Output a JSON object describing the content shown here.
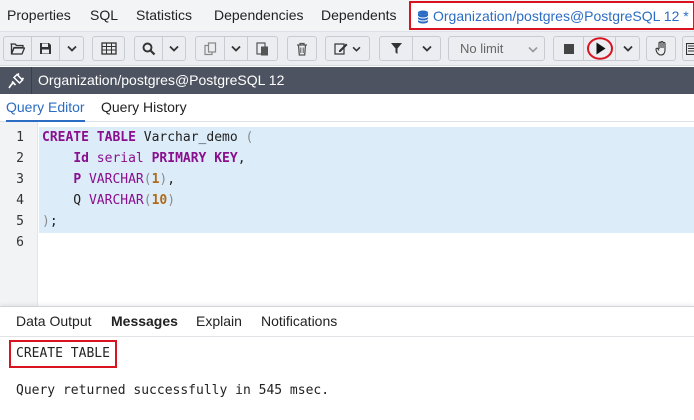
{
  "tabs": [
    {
      "label": "Properties"
    },
    {
      "label": "SQL"
    },
    {
      "label": "Statistics"
    },
    {
      "label": "Dependencies"
    },
    {
      "label": "Dependents"
    },
    {
      "label": "Organization/postgres@PostgreSQL 12 *",
      "active": true
    }
  ],
  "toolbar": {
    "icons": [
      "folder-open-icon",
      "save-icon",
      "chevron-down-icon",
      "grid-icon",
      "search-icon",
      "copy-icon",
      "paste-icon",
      "trash-icon",
      "edit-icon",
      "filter-icon",
      "stop-icon",
      "play-icon",
      "hand-icon"
    ],
    "limit_value": "No limit"
  },
  "connection": {
    "title": "Organization/postgres@PostgreSQL 12"
  },
  "editor_tabs": [
    {
      "label": "Query Editor",
      "active": true
    },
    {
      "label": "Query History"
    }
  ],
  "editor": {
    "line_numbers": [
      "1",
      "2",
      "3",
      "4",
      "5",
      "6"
    ],
    "lines": [
      [
        {
          "t": "CREATE TABLE",
          "c": "kw"
        },
        {
          "t": " Varchar_demo ",
          "c": ""
        },
        {
          "t": "(",
          "c": "pn"
        }
      ],
      [
        {
          "t": "    ",
          "c": ""
        },
        {
          "t": "Id",
          "c": "kw"
        },
        {
          "t": " serial ",
          "c": "ty"
        },
        {
          "t": "PRIMARY KEY",
          "c": "kw"
        },
        {
          "t": ",",
          "c": ""
        }
      ],
      [
        {
          "t": "    ",
          "c": ""
        },
        {
          "t": "P",
          "c": "kw"
        },
        {
          "t": " VARCHAR",
          "c": "ty"
        },
        {
          "t": "(",
          "c": "pn"
        },
        {
          "t": "1",
          "c": "num"
        },
        {
          "t": ")",
          "c": "pn"
        },
        {
          "t": ",",
          "c": ""
        }
      ],
      [
        {
          "t": "    Q ",
          "c": ""
        },
        {
          "t": "VARCHAR",
          "c": "ty"
        },
        {
          "t": "(",
          "c": "pn"
        },
        {
          "t": "10",
          "c": "num"
        },
        {
          "t": ")",
          "c": "pn"
        }
      ],
      [
        {
          "t": ")",
          "c": "pn"
        },
        {
          "t": ";",
          "c": ""
        }
      ],
      []
    ]
  },
  "results": {
    "tabs": [
      {
        "label": "Data Output"
      },
      {
        "label": "Messages",
        "active": true
      },
      {
        "label": "Explain"
      },
      {
        "label": "Notifications"
      }
    ],
    "message": "CREATE TABLE",
    "status": "Query returned successfully in 545 msec."
  },
  "colors": {
    "accent": "#2b6cc4",
    "highlight_red": "#d9131f",
    "connection_bar": "#4d5360",
    "selection": "#dcedf9"
  }
}
